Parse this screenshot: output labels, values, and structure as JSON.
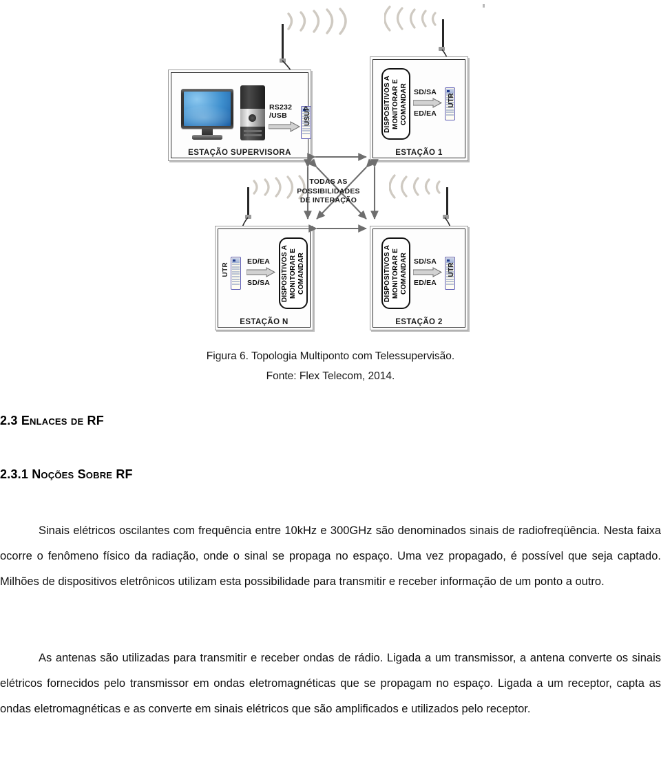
{
  "figure": {
    "stations": [
      {
        "id": "supervisora",
        "label": "ESTAÇÃO SUPERVISORA",
        "interface_label": "RS232\n/USB",
        "interface_line1": "RS232",
        "interface_line2": "/USB",
        "device_label": "USUP"
      },
      {
        "id": "estacao-1",
        "label": "ESTAÇÃO 1",
        "box_text": "DISPOSITIVOS A MONITORAR E COMANDAR",
        "signal_top": "SD/SA",
        "signal_bottom": "ED/EA",
        "device_label": "UTR"
      },
      {
        "id": "estacao-n",
        "label": "ESTAÇÃO N",
        "box_text": "DISPOSITIVOS A MONITORAR E COMANDAR",
        "signal_top": "ED/EA",
        "signal_bottom": "SD/SA",
        "device_label": "UTR"
      },
      {
        "id": "estacao-2",
        "label": "ESTAÇÃO 2",
        "box_text": "DISPOSITIVOS A MONITORAR E COMANDAR",
        "signal_top": "SD/SA",
        "signal_bottom": "ED/EA",
        "device_label": "UTR"
      }
    ],
    "center_note_line1": "TODAS AS",
    "center_note_line2": "POSSIBILIDADES",
    "center_note_line3": "DE INTERAÇÃO",
    "center_note": "TODAS AS POSSIBILIDADES DE INTERAÇÃO",
    "colors": {
      "device_border": "#5b5bb5",
      "station_border": "#9a9a9a",
      "screen_blue": "#3e8fce",
      "arrow_grey": "#c8c8c8",
      "wave_grey": "#cfcac2"
    }
  },
  "caption": {
    "line1": "Figura 6. Topologia Multiponto com Telessupervisão.",
    "line2": "Fonte: Flex Telecom, 2014."
  },
  "headings": {
    "section_23": "2.3 Enlaces de RF",
    "section_231": "2.3.1 Noções Sobre RF"
  },
  "body": {
    "paragraph_1": "Sinais elétricos oscilantes com frequência entre 10kHz e 300GHz são denominados sinais de radiofreqüência. Nesta faixa ocorre o fenômeno físico da radiação, onde o sinal se propaga no espaço. Uma vez propagado, é possível que seja captado. Milhões de dispositivos eletrônicos utilizam esta possibilidade para transmitir e receber informação de um ponto a outro.",
    "paragraph_2": "As antenas são utilizadas para transmitir e receber ondas de rádio. Ligada a um transmissor, a antena converte os sinais elétricos fornecidos pelo transmissor em ondas eletromagnéticas que se propagam no espaço. Ligada a um receptor, capta as ondas eletromagnéticas e as converte em sinais elétricos que são amplificados e utilizados pelo receptor."
  }
}
